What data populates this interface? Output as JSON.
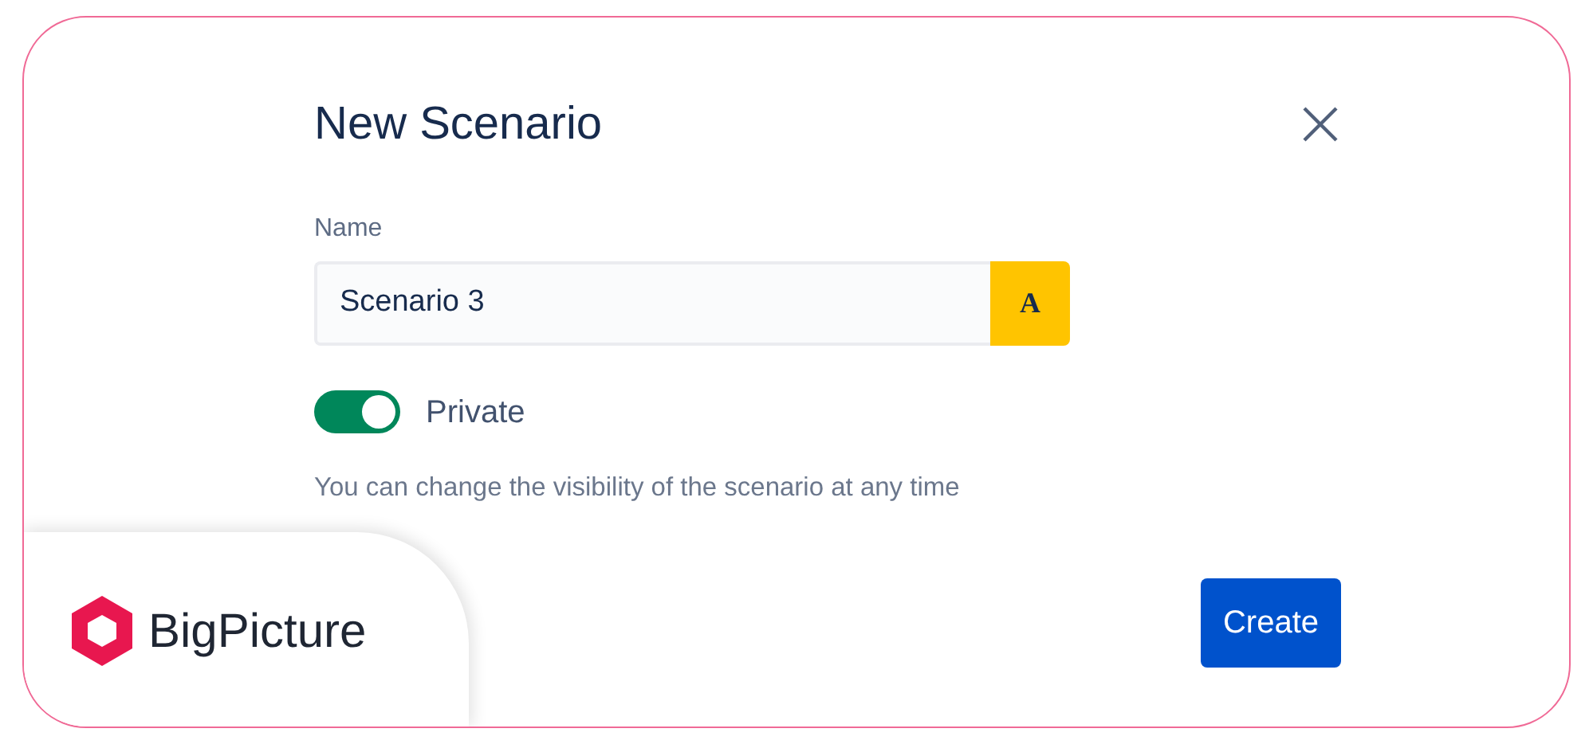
{
  "dialog": {
    "title": "New Scenario",
    "name_field": {
      "label": "Name",
      "value": "Scenario 3",
      "badge": "A"
    },
    "private_toggle": {
      "label": "Private",
      "on": true
    },
    "help_text": "You can change the visibility of the scenario at any time",
    "buttons": [
      {
        "label": "Create",
        "kind": "primary"
      }
    ]
  },
  "brand_badge": {
    "name": "BigPicture"
  }
}
